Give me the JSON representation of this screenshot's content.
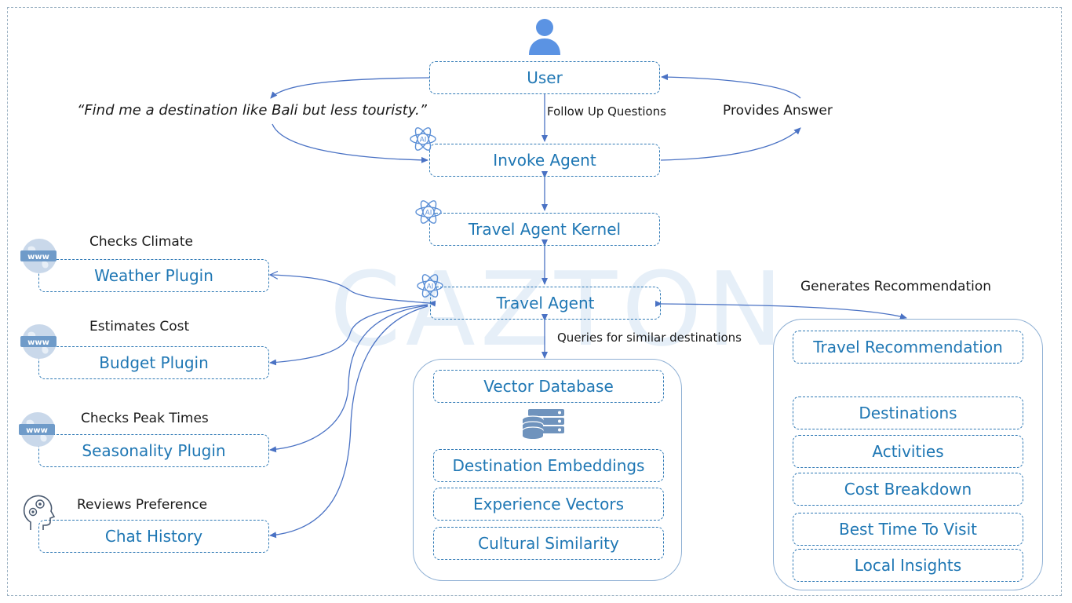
{
  "watermark": "CAZTON",
  "nodes": {
    "user": "User",
    "invoke_agent": "Invoke Agent",
    "kernel": "Travel Agent Kernel",
    "travel_agent": "Travel Agent",
    "weather_plugin": "Weather Plugin",
    "budget_plugin": "Budget Plugin",
    "seasonality_plugin": "Seasonality Plugin",
    "chat_history": "Chat History"
  },
  "annotations": {
    "user_query": "“Find me a destination like Bali but less touristy.”",
    "follow_up": "Follow Up Questions",
    "provides_answer": "Provides Answer",
    "checks_climate": "Checks Climate",
    "estimates_cost": "Estimates Cost",
    "checks_peak": "Checks Peak Times",
    "reviews_pref": "Reviews Preference",
    "generates_rec": "Generates Recommendation",
    "queries_similar": "Queries for similar destinations"
  },
  "vector_group": {
    "title": "Vector Database",
    "items": [
      "Destination Embeddings",
      "Experience Vectors",
      "Cultural Similarity"
    ]
  },
  "recommendation_group": {
    "title": "Travel Recommendation",
    "items": [
      "Destinations",
      "Activities",
      "Cost Breakdown",
      "Best Time To Visit",
      "Local Insights"
    ]
  },
  "icons": {
    "user": "user-icon",
    "ai": "ai-atom-icon",
    "www": "www-globe-icon",
    "brain": "brain-gears-icon",
    "database": "database-server-icon"
  },
  "colors": {
    "box_text": "#1f77b4",
    "box_border": "#2f79b5",
    "arrow": "#4a72c4",
    "icon": "#5b93e3"
  }
}
